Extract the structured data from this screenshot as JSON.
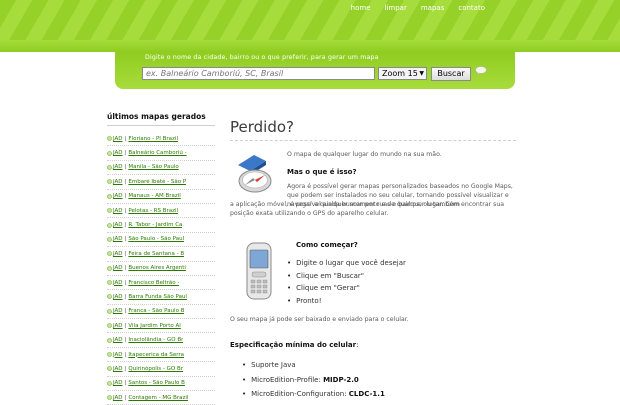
{
  "nav": {
    "home": "home",
    "limpar": "limpar",
    "mapas": "mapas",
    "contato": "contato"
  },
  "search": {
    "hint": "Digite o nome da cidade, bairro ou o que preferir, para gerar um mapa",
    "placeholder": "ex. Balneário Camboriú, SC, Brasil",
    "zoom": "Zoom 15",
    "button": "Buscar"
  },
  "sidebar": {
    "title": "últimos mapas gerados",
    "jad": "JAD",
    "items": [
      "Floriano - PI Brazil",
      "Balneário Camboriú -",
      "Manila - São Paulo",
      "Embaré Ibaté - São P",
      "Manaus - AM Brazil",
      "Pelotas - RS Brazil",
      "R. Tabor - Jardim Ca",
      "São Paulo - São Paul",
      "Feira de Santana - B",
      "Buenos Aires Argenti",
      "Francisco Beltrão -",
      "Barra Funda São Paul",
      "Franca - São Paulo B",
      "Vila Jardim Porto Al",
      "Inaciolândia - GO Br",
      "Itapecerica da Serra",
      "Quirinópolis - GO Br",
      "Santos - São Paulo B",
      "Contagem - MG Brazil"
    ]
  },
  "main": {
    "title": "Perdido?",
    "intro": "O mapa de qualquer lugar do mundo na sua mão.",
    "subtitle1": "Mas o que é isso?",
    "desc_a": "Agora é possível gerar mapas personalizados baseados no Google Maps, que podem ser instalados no seu celular, tornando possível visualizar e navegar a qualquer momento e de qualquer lugar. Com",
    "desc_b": "a aplicação móvel, é possível ainda buscar por ruas e bairros, ou também encontrar sua posição exata utilizando o GPS do aparelho celular.",
    "subtitle2": "Como começar?",
    "steps": [
      "Digite o lugar que você desejar",
      "Clique em \"Buscar\"",
      "Clique em \"Gerar\"",
      "Pronto!"
    ],
    "final": "O seu mapa já pode ser baixado e enviado para o celular.",
    "spec_title": "Especificação mínima do celular",
    "spec_colon": ":",
    "specs": [
      {
        "label": "Suporte Java",
        "value": ""
      },
      {
        "label": "MicroEdition-Profile: ",
        "value": "MIDP-2.0"
      },
      {
        "label": "MicroEdition-Configuration: ",
        "value": "CLDC-1.1"
      }
    ]
  },
  "colors": {
    "brand_green": "#96d12a",
    "link_green": "#2a7a00"
  }
}
